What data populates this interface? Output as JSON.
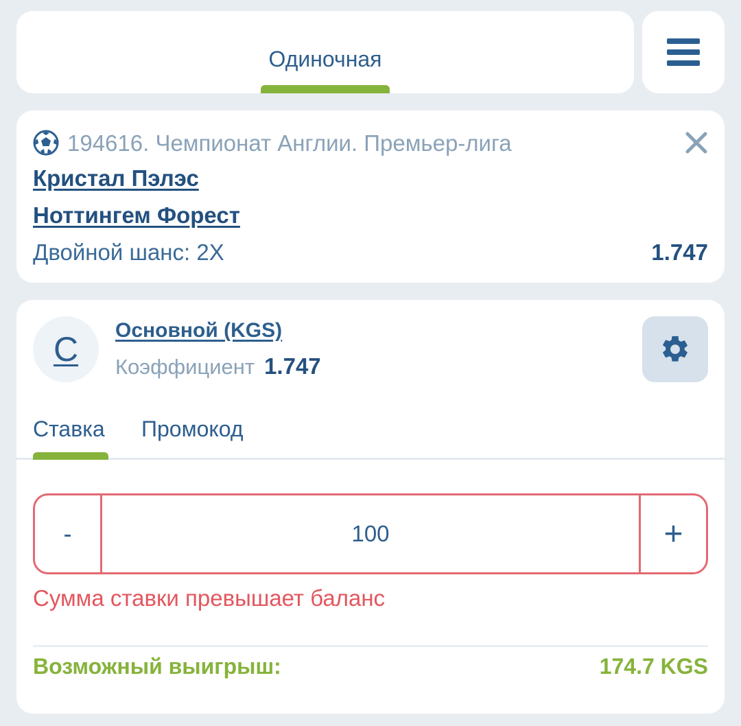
{
  "header": {
    "tab_label": "Одиночная",
    "menu_icon": "hamburger-menu-icon"
  },
  "event": {
    "sport_icon": "soccer-ball-icon",
    "league": "194616. Чемпионат Англии. Премьер-лига",
    "home_team": "Кристал Пэлэс",
    "away_team": "Ноттингем Форест",
    "market": "Двойной шанс: 2X",
    "odds": "1.747",
    "close_icon": "close-icon"
  },
  "bet": {
    "avatar_letter": "С",
    "account": "Основной (KGS)",
    "coef_label": "Коэффициент",
    "coef_value": "1.747",
    "settings_icon": "gear-icon",
    "tabs": {
      "stake": "Ставка",
      "promo": "Промокод"
    },
    "stepper": {
      "minus": "-",
      "amount": "100",
      "plus": "+"
    },
    "error": "Сумма ставки превышает баланс",
    "win_label": "Возможный выигрыш:",
    "win_value": "174.7 KGS"
  },
  "colors": {
    "background": "#e8edf2",
    "primary": "#2d5e8e",
    "accent_green": "#86b33b",
    "error_red": "#e3565e",
    "muted": "#8aa2b8"
  }
}
